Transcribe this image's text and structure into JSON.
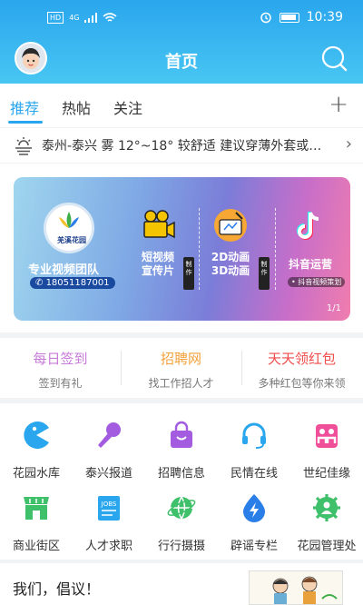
{
  "status_bar": {
    "left_badge": "HD",
    "network": "4G",
    "time": "10:39"
  },
  "header": {
    "title": "首页"
  },
  "tabs": [
    {
      "label": "推荐",
      "active": true
    },
    {
      "label": "热帖",
      "active": false
    },
    {
      "label": "关注",
      "active": false
    }
  ],
  "tab_add": "+",
  "weather": {
    "text": "泰州-泰兴 雾 12°~18° 较舒适 建议穿薄外套或…"
  },
  "banner": {
    "logo_text": "羌溪花园",
    "team": "专业视频团队",
    "phone": "18051187001",
    "items": [
      {
        "label1": "短视频",
        "label2": "宣传片",
        "badge": "制作"
      },
      {
        "label1": "2D动画",
        "label2": "3D动画",
        "badge": "制作"
      },
      {
        "label1": "抖音运营",
        "label2": "",
        "badge": ""
      }
    ],
    "douyin_sub": "• 抖音视频策划",
    "pager": "1/1"
  },
  "quick_links": [
    {
      "title": "每日签到",
      "subtitle": "签到有礼",
      "color": "#c77ad8"
    },
    {
      "title": "招聘网",
      "subtitle": "找工作招人才",
      "color": "#f2a13a"
    },
    {
      "title": "天天领红包",
      "subtitle": "多种红包等你来领",
      "color": "#f04b4b"
    }
  ],
  "grid": [
    {
      "label": "花园水库",
      "icon": "pacman-icon",
      "color": "#2aa6ee"
    },
    {
      "label": "泰兴报道",
      "icon": "microphone-icon",
      "color": "#a35ce0"
    },
    {
      "label": "招聘信息",
      "icon": "shopping-bag-icon",
      "color": "#a35ce0"
    },
    {
      "label": "民情在线",
      "icon": "headset-icon",
      "color": "#2aa6ee"
    },
    {
      "label": "世纪佳缘",
      "icon": "couple-icon",
      "color": "#f0509a"
    },
    {
      "label": "商业街区",
      "icon": "storefront-icon",
      "color": "#3fc06a"
    },
    {
      "label": "人才求职",
      "icon": "jobs-icon",
      "color": "#2aa6ee"
    },
    {
      "label": "行行摄摄",
      "icon": "globe-icon",
      "color": "#3fc06a"
    },
    {
      "label": "辟谣专栏",
      "icon": "lightning-icon",
      "color": "#2a7ee8"
    },
    {
      "label": "花园管理处",
      "icon": "gear-person-icon",
      "color": "#3fc06a"
    }
  ],
  "article": {
    "title": "我们，倡议！"
  }
}
